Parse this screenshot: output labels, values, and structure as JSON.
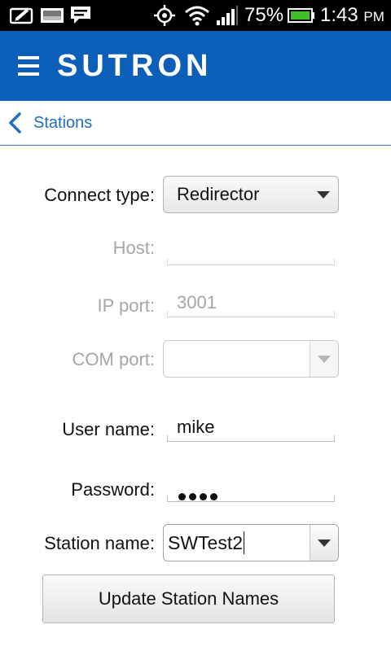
{
  "status_bar": {
    "battery_percent": "75%",
    "time": "1:43",
    "ampm": "PM",
    "icons": [
      "notification-icon",
      "image-icon",
      "message-icon",
      "gps-icon",
      "wifi-icon",
      "signal-icon",
      "battery-icon"
    ],
    "battery_color": "#3fbf2a"
  },
  "app_bar": {
    "brand": "SUTRON",
    "color": "#0b5fb8"
  },
  "breadcrumb": {
    "label": "Stations"
  },
  "form": {
    "connect_type": {
      "label": "Connect type:",
      "value": "Redirector"
    },
    "host": {
      "label": "Host:",
      "value": ""
    },
    "ip_port": {
      "label": "IP port:",
      "value": "3001"
    },
    "com_port": {
      "label": "COM port:",
      "value": ""
    },
    "user_name": {
      "label": "User name:",
      "value": "mike"
    },
    "password": {
      "label": "Password:",
      "value": "••••",
      "length": 4
    },
    "station_name": {
      "label": "Station name:",
      "value": "SWTest2"
    }
  },
  "update_button": {
    "label": "Update Station Names"
  }
}
